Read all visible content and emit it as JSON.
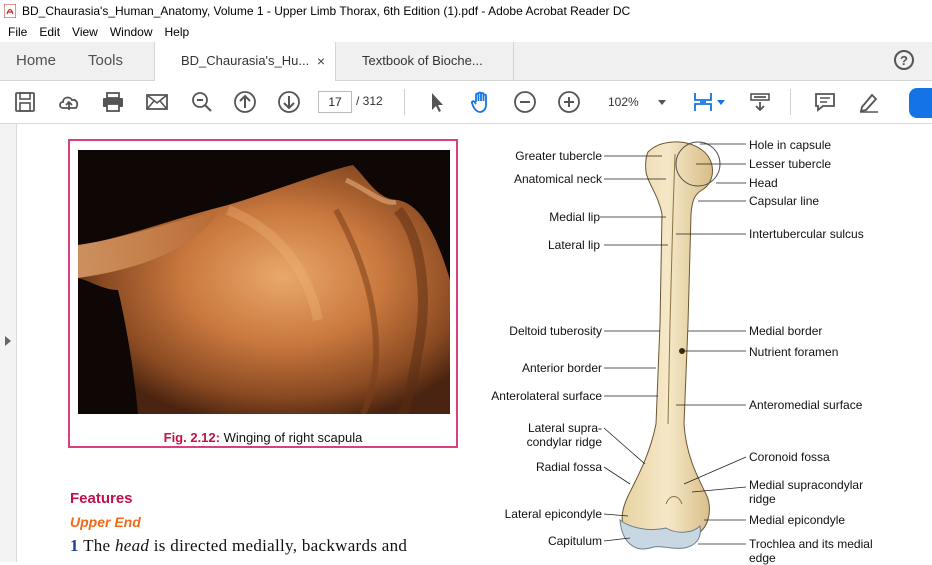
{
  "window": {
    "title": "BD_Chaurasia's_Human_Anatomy, Volume 1 - Upper Limb Thorax, 6th Edition (1).pdf - Adobe Acrobat Reader DC"
  },
  "menu": [
    "File",
    "Edit",
    "View",
    "Window",
    "Help"
  ],
  "tabs": {
    "home": "Home",
    "tools": "Tools",
    "docs": [
      {
        "label": "BD_Chaurasia's_Hu...",
        "close": "×"
      },
      {
        "label": "Textbook of Bioche..."
      }
    ],
    "help": "?"
  },
  "toolbar": {
    "page_current": "17",
    "page_total": "/ 312",
    "zoom": "102%"
  },
  "document": {
    "figure_caption_label": "Fig. 2.12:",
    "figure_caption_text": "Winging of right scapula",
    "heading": "Features",
    "subheading": "Upper End",
    "para_number": "1",
    "para_pre": "The",
    "para_italic": "head",
    "para_post": "is directed medially, backwards and",
    "bone_labels_left": [
      "Greater tubercle",
      "Anatomical neck",
      "Medial lip",
      "Lateral lip",
      "Deltoid tuberosity",
      "Anterior border",
      "Anterolateral surface",
      "Lateral supra-",
      "condylar ridge",
      "Radial fossa",
      "Lateral epicondyle",
      "Capitulum"
    ],
    "bone_labels_right": [
      "Hole in capsule",
      "Lesser tubercle",
      "Head",
      "Capsular line",
      "Intertubercular sulcus",
      "Medial border",
      "Nutrient foramen",
      "Anteromedial surface",
      "Coronoid fossa",
      "Medial supracondylar",
      "ridge",
      "Medial epicondyle",
      "Trochlea and its medial",
      "edge"
    ]
  },
  "colors": {
    "accent_blue": "#1473e6",
    "caption_pink": "#c0124a",
    "subheading_orange": "#f06a1a",
    "frame_pink": "#d9407e"
  }
}
